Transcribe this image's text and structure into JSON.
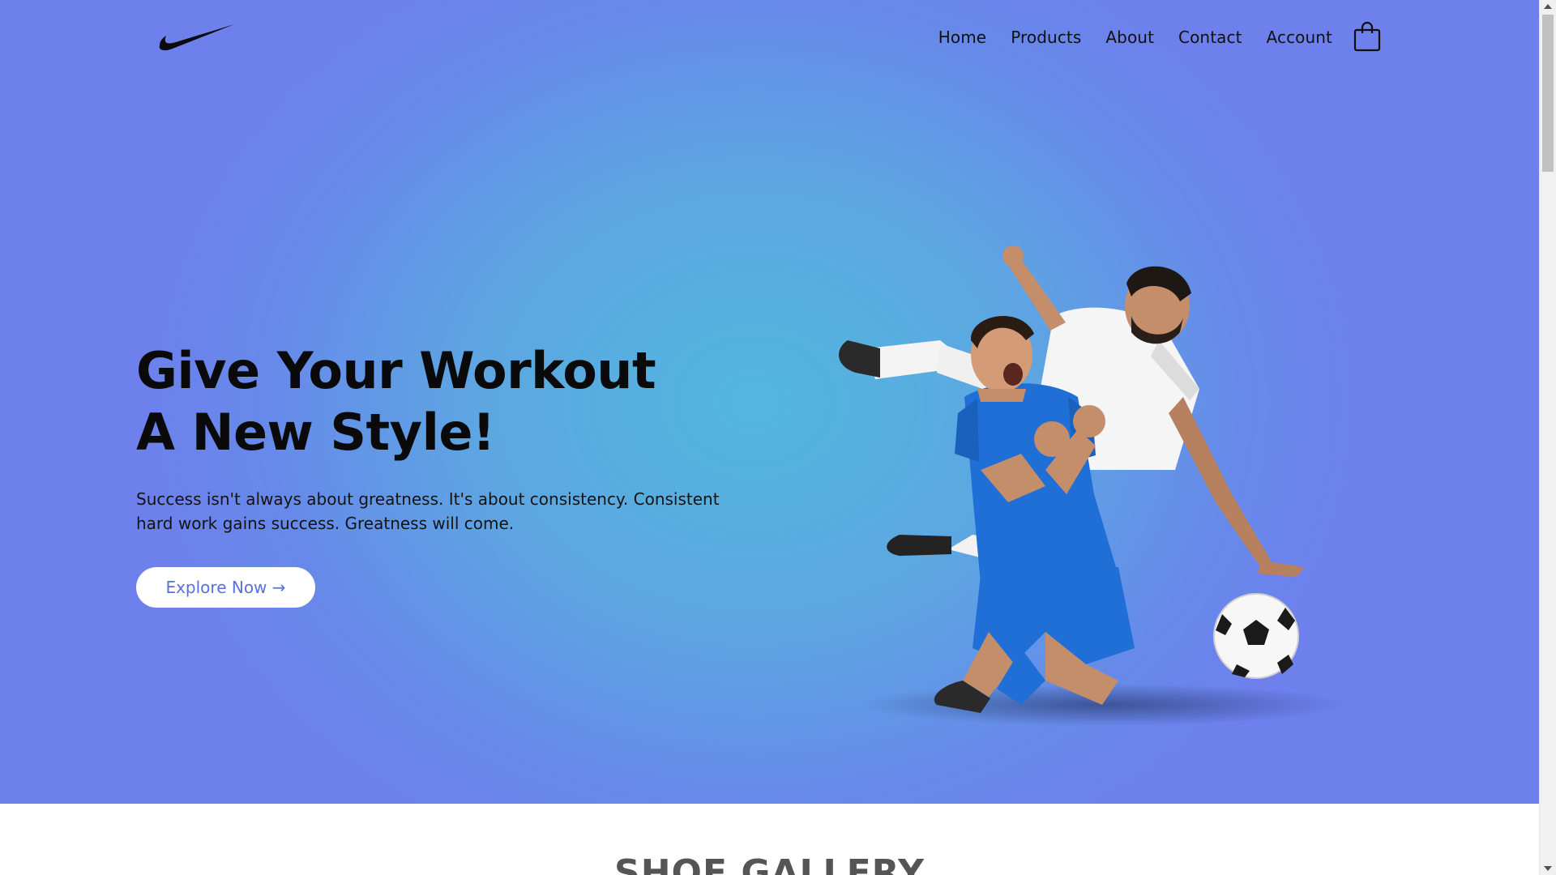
{
  "colors": {
    "hero_gradient_center": "#52b7de",
    "hero_gradient_edge": "#6d80ec",
    "headline": "#0a0a0a",
    "cta_text": "#5a70dc",
    "cta_background": "#ffffff",
    "jersey_blue": "#1f6fd6"
  },
  "header": {
    "logo_icon": "swoosh-logo",
    "nav": [
      {
        "label": "Home"
      },
      {
        "label": "Products"
      },
      {
        "label": "About"
      },
      {
        "label": "Contact"
      },
      {
        "label": "Account"
      }
    ],
    "cart_icon": "shopping-bag-icon"
  },
  "hero": {
    "headline_line1": "Give Your Workout",
    "headline_line2": "A New Style!",
    "description": "Success isn't always about greatness. It's about consistency. Consistent hard work gains success. Greatness will come.",
    "cta_label": "Explore Now →",
    "image_icon": "soccer-players-illustration"
  },
  "gallery": {
    "title": "SHOE GALLERY"
  }
}
